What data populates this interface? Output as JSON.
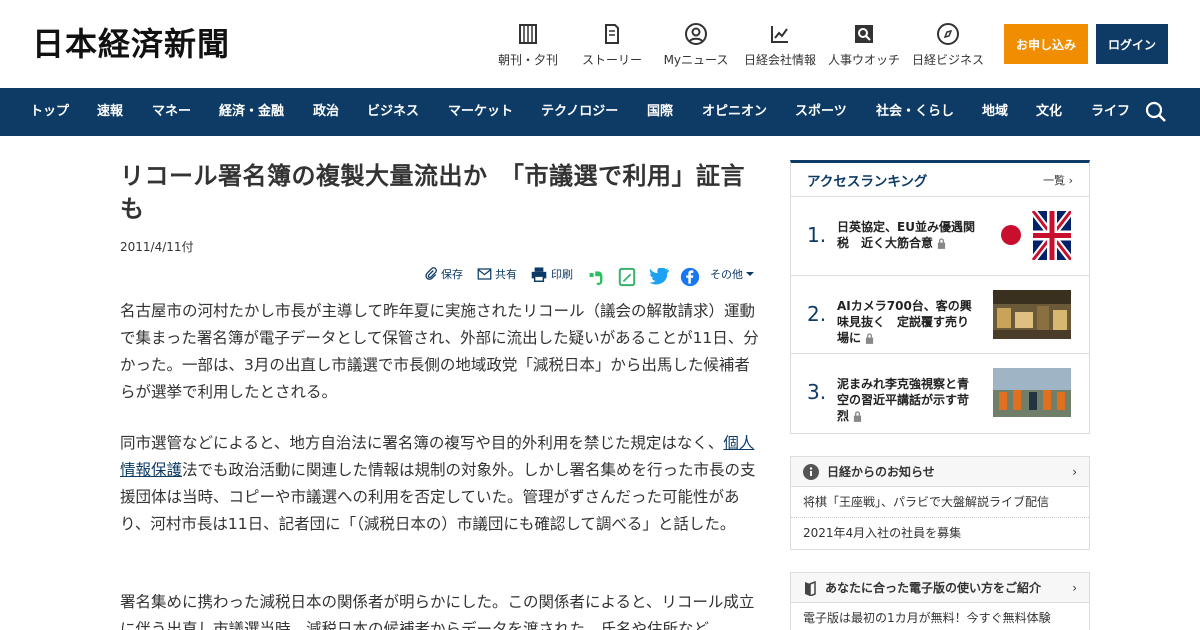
{
  "header": {
    "logo": "日本経済新聞",
    "services": [
      {
        "label": "朝刊・夕刊",
        "icon": "newspaper-icon"
      },
      {
        "label": "ストーリー",
        "icon": "document-icon"
      },
      {
        "label": "Myニュース",
        "icon": "user-icon"
      },
      {
        "label": "日経会社情報",
        "icon": "chart-icon"
      },
      {
        "label": "人事ウオッチ",
        "icon": "magnifier-icon"
      },
      {
        "label": "日経ビジネス",
        "icon": "compass-icon"
      }
    ],
    "subscribe_label": "お申し込み",
    "login_label": "ログイン"
  },
  "nav": {
    "items": [
      "トップ",
      "速報",
      "マネー",
      "経済・金融",
      "政治",
      "ビジネス",
      "マーケット",
      "テクノロジー",
      "国際",
      "オピニオン",
      "スポーツ",
      "社会・くらし",
      "地域",
      "文化",
      "ライフ"
    ]
  },
  "article": {
    "title": "リコール署名簿の複製大量流出か　「市議選で利用」証言も",
    "date": "2011/4/11付",
    "tools": {
      "save": "保存",
      "share": "共有",
      "print": "印刷",
      "more": "その他"
    },
    "p1": "名古屋市の河村たかし市長が主導して昨年夏に実施されたリコール（議会の解散請求）運動で集まった署名簿が電子データとして保管され、外部に流出した疑いがあることが11日、分かった。一部は、3月の出直し市議選で市長側の地域政党「減税日本」から出馬した候補者らが選挙で利用したとされる。",
    "p2_pre": "同市選管などによると、地方自治法に署名簿の複写や目的外利用を禁じた規定はなく、",
    "p2_link": "個人情報保護",
    "p2_post": "法でも政治活動に関連した情報は規制の対象外。しかし署名集めを行った市長の支援団体は当時、コピーや市議選への利用を否定していた。管理がずさんだった可能性があり、河村市長は11日、記者団に「（減税日本の）市議団にも確認して調べる」と話した。",
    "p3": "署名集めに携わった減税日本の関係者が明らかにした。この関係者によると、リコール成立に伴う出直し市議選当時、減税日本の候補者からデータを渡された。氏名や住所など"
  },
  "ranking": {
    "title": "アクセスランキング",
    "more": "一覧",
    "items": [
      {
        "rank": "1.",
        "headline": "日英協定、EU並み優遇関税　近く大筋合意"
      },
      {
        "rank": "2.",
        "headline": "AIカメラ700台、客の興味見抜く　定説覆す売り場に"
      },
      {
        "rank": "3.",
        "headline": "泥まみれ李克強視察と青空の習近平講話が示す苛烈"
      }
    ]
  },
  "notice": {
    "title": "日経からのお知らせ",
    "items": [
      "将棋「王座戦」、パラビで大盤解説ライブ配信",
      "2021年4月入社の社員を募集"
    ]
  },
  "guide": {
    "title": "あなたに合った電子版の使い方をご紹介",
    "items": [
      "電子版は最初の1カ月が無料！今すぐ無料体験"
    ]
  },
  "colors": {
    "brand": "#0d3b66",
    "accent": "#f18d00"
  }
}
